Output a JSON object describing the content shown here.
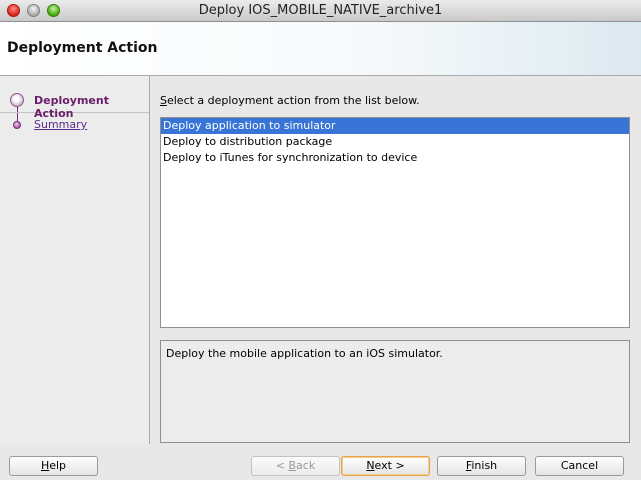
{
  "window": {
    "title": "Deploy IOS_MOBILE_NATIVE_archive1"
  },
  "header": {
    "title": "Deployment Action"
  },
  "steps": [
    {
      "label": "Deployment Action",
      "state": "active"
    },
    {
      "label": "Summary",
      "state": "link"
    }
  ],
  "instruction": {
    "mnemonic": "S",
    "rest": "elect a deployment action from the list below."
  },
  "actions": {
    "items": [
      {
        "label": "Deploy application to simulator",
        "selected": true
      },
      {
        "label": "Deploy to distribution package",
        "selected": false
      },
      {
        "label": "Deploy to iTunes for synchronization to device",
        "selected": false
      }
    ],
    "selection_color": "#3875d7"
  },
  "description": "Deploy the mobile application to an iOS simulator.",
  "buttons": {
    "help": {
      "mn": "H",
      "rest": "elp"
    },
    "back": {
      "pre": "< ",
      "mn": "B",
      "rest": "ack",
      "disabled": true
    },
    "next": {
      "mn": "N",
      "rest": "ext >",
      "default": true
    },
    "finish": {
      "mn": "F",
      "rest": "inish"
    },
    "cancel": {
      "label": "Cancel"
    }
  },
  "icons": [
    "close-window-icon",
    "minimize-window-icon",
    "zoom-window-icon",
    "step-indicator-icon"
  ]
}
